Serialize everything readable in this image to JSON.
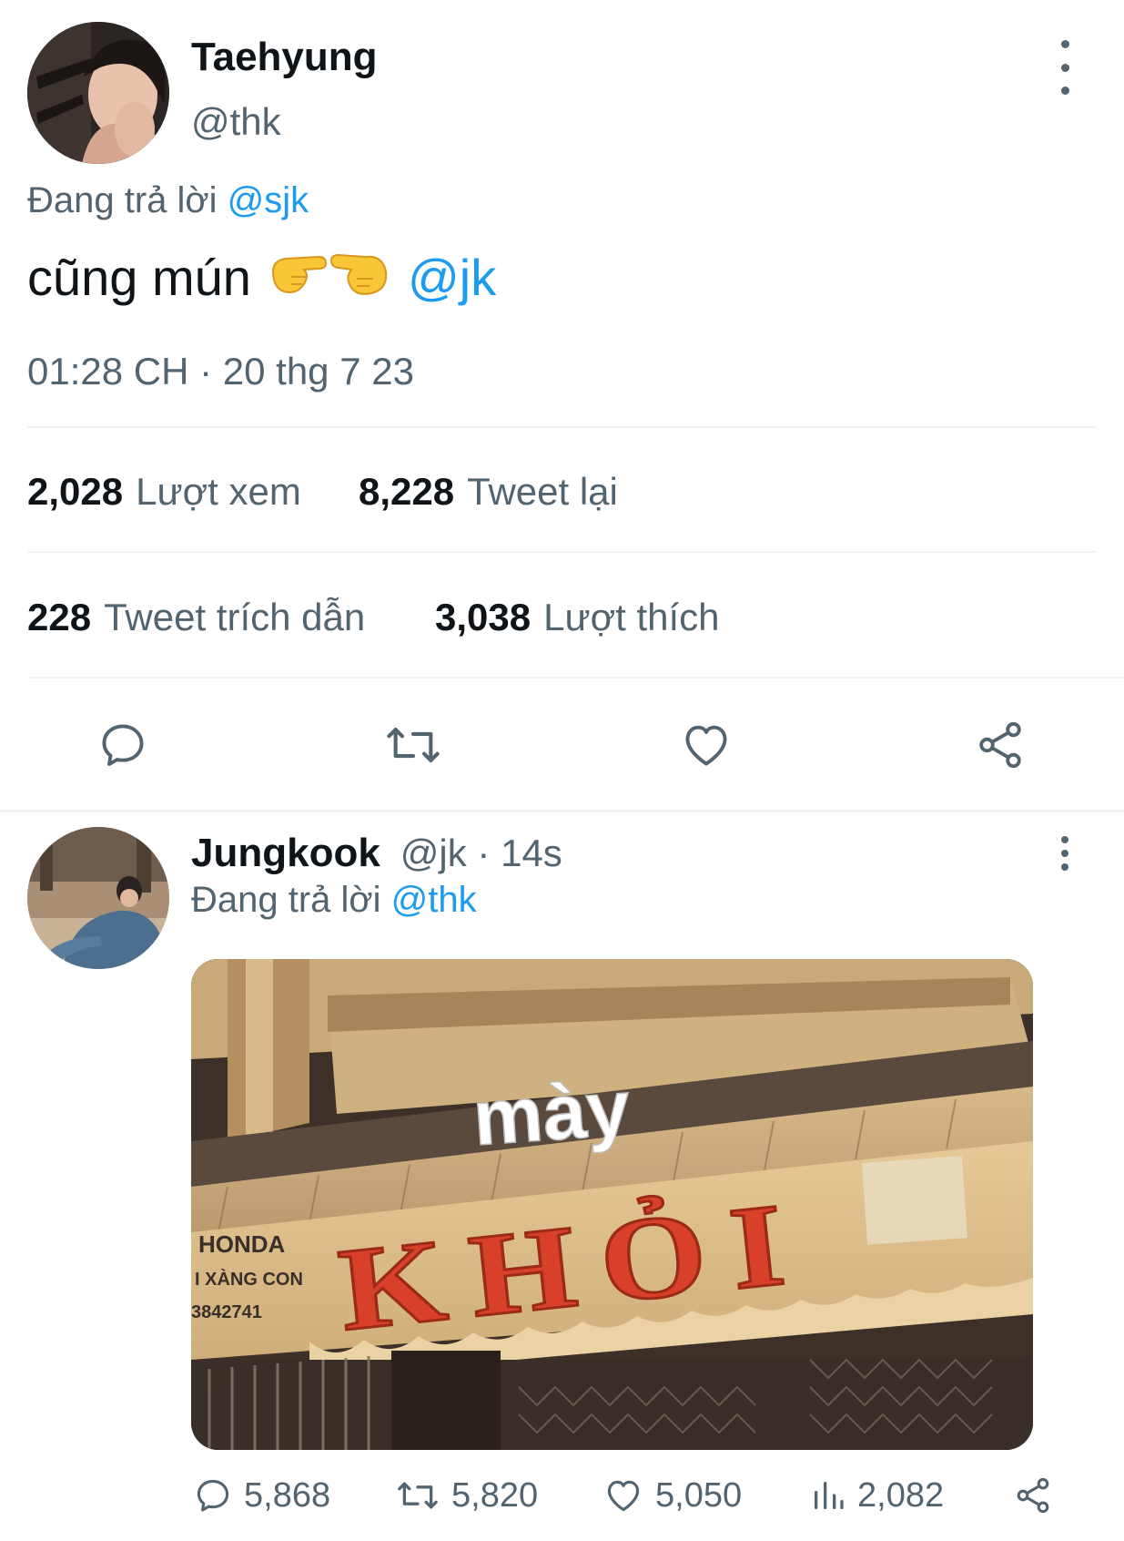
{
  "tweet": {
    "author_name": "Taehyung",
    "author_handle": "@thk",
    "replying_prefix": "Đang trả lời",
    "replying_to": "@sjk",
    "text": "cũng mún",
    "mention": "@jk",
    "timestamp": "01:28 CH · 20 thg 7 23",
    "stats": {
      "views_count": "2,028",
      "views_label": "Lượt xem",
      "retweets_count": "8,228",
      "retweets_label": "Tweet lại",
      "quotes_count": "228",
      "quotes_label": "Tweet trích dẫn",
      "likes_count": "3,038",
      "likes_label": "Lượt thích"
    }
  },
  "reply": {
    "author_name": "Jungkook",
    "author_handle": "@jk",
    "time_sep": " · 14s",
    "replying_prefix": "Đang trả lời",
    "replying_to": "@thk",
    "image": {
      "overlay_text": "mày",
      "sign_text": "KHỎI",
      "side_sign_lines": [
        "HONDA",
        "I XÀNG CON",
        "3842741"
      ]
    },
    "metrics": {
      "replies": "5,868",
      "retweets": "5,820",
      "likes": "5,050",
      "views": "2,082"
    }
  },
  "icons": {
    "more": "more-vertical-icon",
    "reply": "reply-bubble-icon",
    "retweet": "retweet-icon",
    "like": "heart-icon",
    "share": "share-icon",
    "views": "bar-chart-icon",
    "pointing": "pointing-hand-emoji"
  },
  "colors": {
    "link": "#1d9bf0",
    "secondary_text": "#536471",
    "divider": "#eff3f4"
  }
}
